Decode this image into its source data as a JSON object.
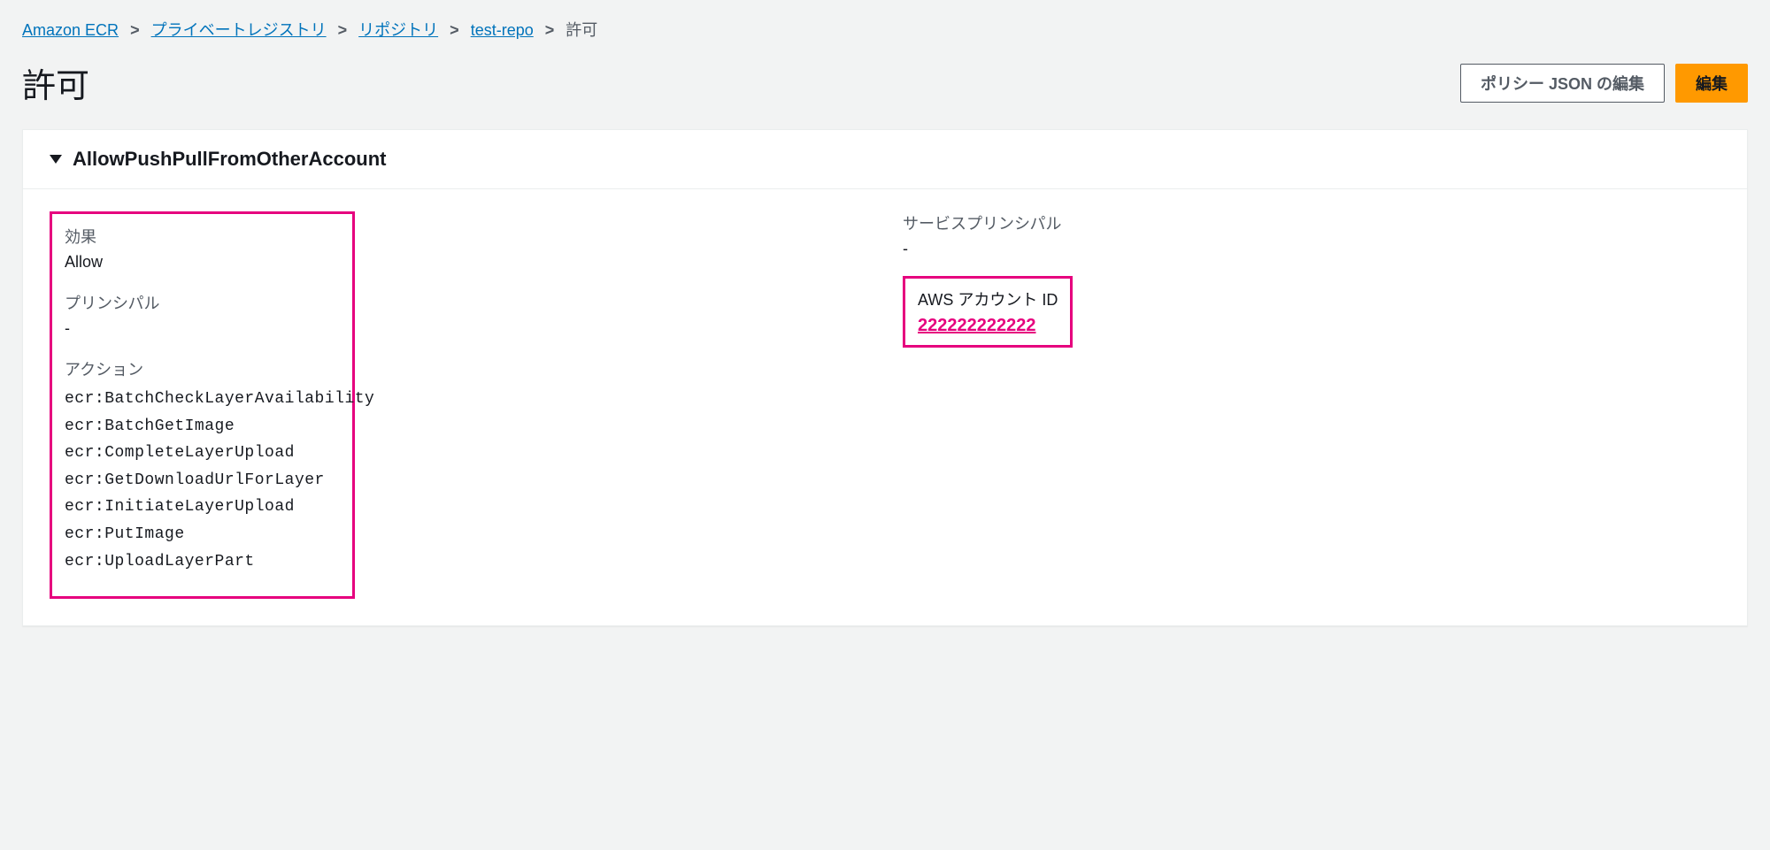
{
  "breadcrumb": {
    "items": [
      {
        "label": "Amazon ECR"
      },
      {
        "label": "プライベートレジストリ"
      },
      {
        "label": "リポジトリ"
      },
      {
        "label": "test-repo"
      }
    ],
    "current": "許可",
    "separator": ">"
  },
  "header": {
    "title": "許可",
    "edit_json_label": "ポリシー JSON の編集",
    "edit_label": "編集"
  },
  "statement": {
    "name": "AllowPushPullFromOtherAccount",
    "effect_label": "効果",
    "effect_value": "Allow",
    "principal_label": "プリンシパル",
    "principal_value": "-",
    "action_label": "アクション",
    "actions": [
      "ecr:BatchCheckLayerAvailability",
      "ecr:BatchGetImage",
      "ecr:CompleteLayerUpload",
      "ecr:GetDownloadUrlForLayer",
      "ecr:InitiateLayerUpload",
      "ecr:PutImage",
      "ecr:UploadLayerPart"
    ],
    "service_principal_label": "サービスプリンシパル",
    "service_principal_value": "-",
    "aws_account_label": "AWS アカウント ID",
    "aws_account_value": "222222222222"
  }
}
